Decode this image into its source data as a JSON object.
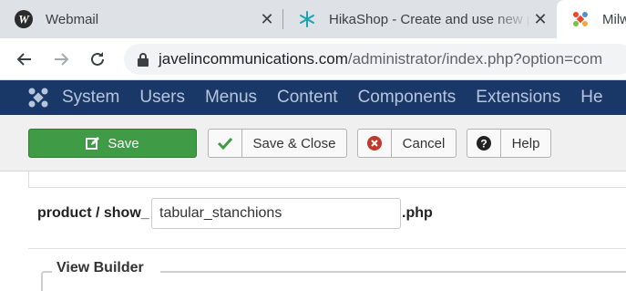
{
  "browser": {
    "tabs": [
      {
        "title": "Webmail",
        "icon": "webmail-w-icon"
      },
      {
        "title": "HikaShop - Create and use new p",
        "icon": "hikashop-icon"
      },
      {
        "title": "Milwa",
        "icon": "joomla-icon",
        "active": true
      }
    ],
    "address": {
      "domain": "javelincommunications.com",
      "path": "/administrator/index.php?option=com"
    }
  },
  "joomla_menu": {
    "items": [
      "System",
      "Users",
      "Menus",
      "Content",
      "Components",
      "Extensions",
      "He"
    ]
  },
  "toolbar": {
    "save_label": "Save",
    "save_close_label": "Save & Close",
    "cancel_label": "Cancel",
    "help_label": "Help"
  },
  "form": {
    "prefix_label": "product / show_",
    "filename_value": "tabular_stanchions",
    "suffix_label": ".php",
    "view_builder_legend": "View Builder"
  },
  "colors": {
    "admin_menu_bg": "#1a3867",
    "save_green": "#3f9b45",
    "cancel_red": "#c0392b"
  }
}
